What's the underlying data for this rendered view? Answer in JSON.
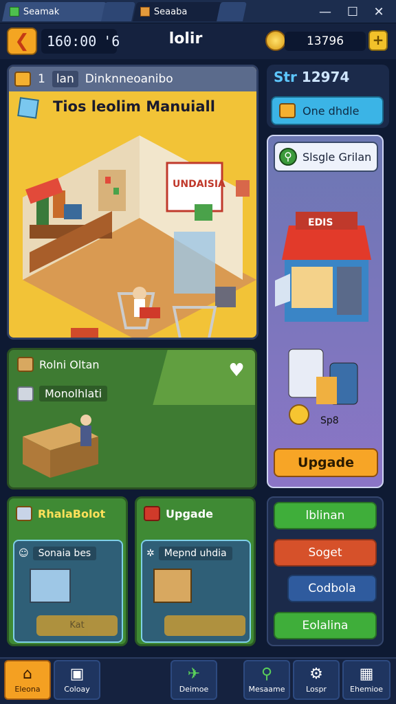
{
  "titlebar": {
    "tabs": [
      {
        "label": "Seamak"
      },
      {
        "label": ""
      },
      {
        "label": "Seaaba"
      }
    ],
    "minimize": "—",
    "maximize": "☐",
    "close": "✕"
  },
  "header": {
    "back": "❮",
    "time": "160:00",
    "time_suffix": "'6",
    "title": "lolir",
    "coins": "13796",
    "add": "+"
  },
  "shop_panel": {
    "tabs": [
      "1",
      "lan",
      "Dinknneoanibo"
    ],
    "title": "Tios leolim Manuiall",
    "sign": "UNDAISIA"
  },
  "stats": {
    "prefix": "Str",
    "value": "12974",
    "one_button": "One dhdle"
  },
  "side_panel": {
    "bubble": "Slsgle Grilan",
    "store_sign": "EDIS",
    "spy_label": "Sp8",
    "upgrade": "Upgade"
  },
  "green_panel": {
    "row1": "Rolni Oltan",
    "row2": "Monolhlati"
  },
  "cards": [
    {
      "title": "RhalaBolot",
      "inner_label": "Sonaia bes",
      "button": "Kat"
    },
    {
      "title": "Upgade",
      "inner_label": "Mepnd uhdia",
      "button": ""
    }
  ],
  "actions": [
    {
      "label": "lblinan",
      "color": "#3fae3a"
    },
    {
      "label": "Soget",
      "color": "#d6512a"
    },
    {
      "label": "Codbola",
      "color": "#2f5b9e"
    },
    {
      "label": "Eolalina",
      "color": "#3fae3a"
    }
  ],
  "nav": [
    {
      "label": "Eleona",
      "icon": "⌂"
    },
    {
      "label": "Coloay",
      "icon": "▣"
    },
    {
      "label": "Deimoe",
      "icon": "✈"
    },
    {
      "label": "Mesaame",
      "icon": "⚲"
    },
    {
      "label": "Lospr",
      "icon": "⚙"
    },
    {
      "label": "Ehemioe",
      "icon": "▦"
    }
  ]
}
